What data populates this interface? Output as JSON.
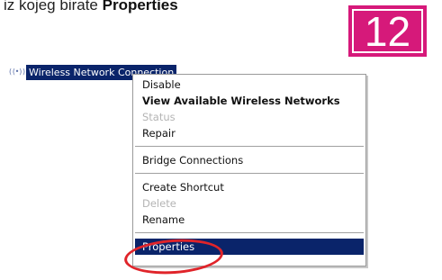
{
  "caption": {
    "prefix": "iz kojeg birate ",
    "emphasis": "Properties"
  },
  "step_number": "12",
  "connection": {
    "icon": "wireless-network-icon",
    "label": "Wireless Network Connection"
  },
  "context_menu": {
    "items": {
      "disable": "Disable",
      "view_networks": "View Available Wireless Networks",
      "status": "Status",
      "repair": "Repair",
      "bridge": "Bridge Connections",
      "create_shortcut": "Create Shortcut",
      "delete": "Delete",
      "rename": "Rename",
      "properties": "Properties"
    },
    "selected": "properties"
  },
  "colors": {
    "badge": "#d6197a",
    "selection": "#0a246a",
    "annotation_ring": "#e0242a"
  }
}
